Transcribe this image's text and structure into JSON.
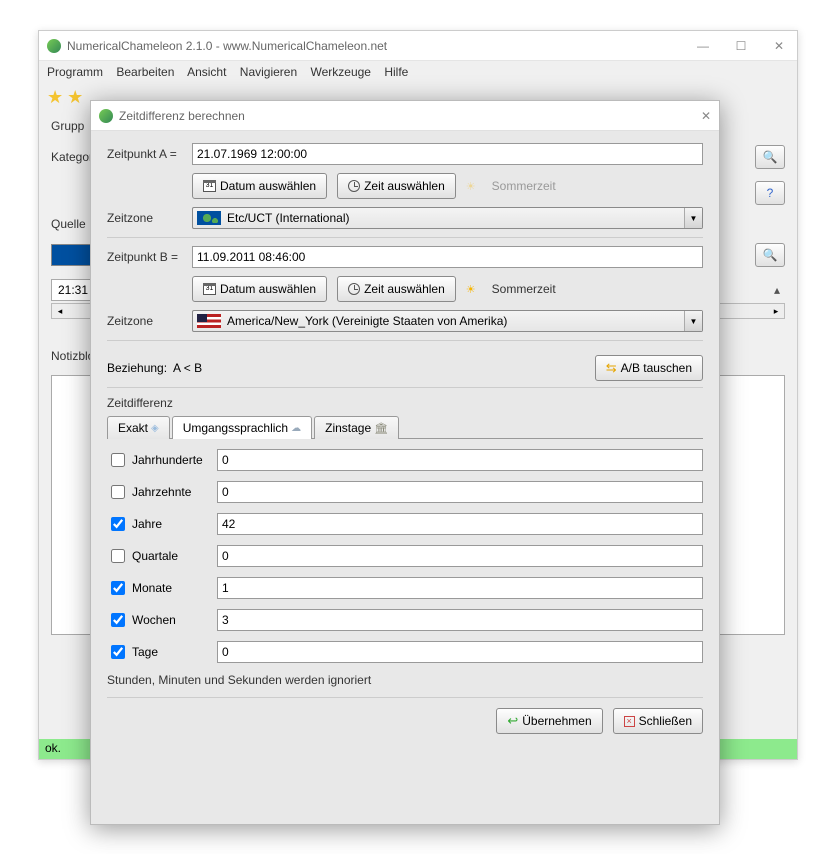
{
  "main": {
    "title": "NumericalChameleon 2.1.0 - www.NumericalChameleon.net",
    "menus": [
      "Programm",
      "Bearbeiten",
      "Ansicht",
      "Navigieren",
      "Werkzeuge",
      "Hilfe"
    ],
    "labels": {
      "grupp": "Grupp",
      "kategorie": "Kategori",
      "quelle": "Quelle",
      "notizblock": "Notizbloc"
    },
    "time_val": "21:31",
    "status": "ok."
  },
  "dialog": {
    "title": "Zeitdifferenz berechnen",
    "a": {
      "label": "Zeitpunkt A =",
      "value": "21.07.1969 12:00:00",
      "tz_label": "Zeitzone",
      "tz_value": "Etc/UCT (International)",
      "sommer": "Sommerzeit",
      "pick_date": "Datum auswählen",
      "pick_time": "Zeit auswählen"
    },
    "b": {
      "label": "Zeitpunkt B =",
      "value": "11.09.2011 08:46:00",
      "tz_label": "Zeitzone",
      "tz_value": "America/New_York (Vereinigte Staaten von Amerika)",
      "sommer": "Sommerzeit",
      "pick_date": "Datum auswählen",
      "pick_time": "Zeit auswählen"
    },
    "relation_label": "Beziehung:",
    "relation_value": "A < B",
    "swap": "A/B tauschen",
    "diff_legend": "Zeitdifferenz",
    "tabs": {
      "exact": "Exakt",
      "colloquial": "Umgangssprachlich",
      "interest": "Zinstage"
    },
    "rows": [
      {
        "label": "Jahrhunderte",
        "checked": false,
        "value": "0"
      },
      {
        "label": "Jahrzehnte",
        "checked": false,
        "value": "0"
      },
      {
        "label": "Jahre",
        "checked": true,
        "value": "42"
      },
      {
        "label": "Quartale",
        "checked": false,
        "value": "0"
      },
      {
        "label": "Monate",
        "checked": true,
        "value": "1"
      },
      {
        "label": "Wochen",
        "checked": true,
        "value": "3"
      },
      {
        "label": "Tage",
        "checked": true,
        "value": "0"
      }
    ],
    "note": "Stunden, Minuten und Sekunden werden ignoriert",
    "apply": "Übernehmen",
    "close": "Schließen"
  }
}
